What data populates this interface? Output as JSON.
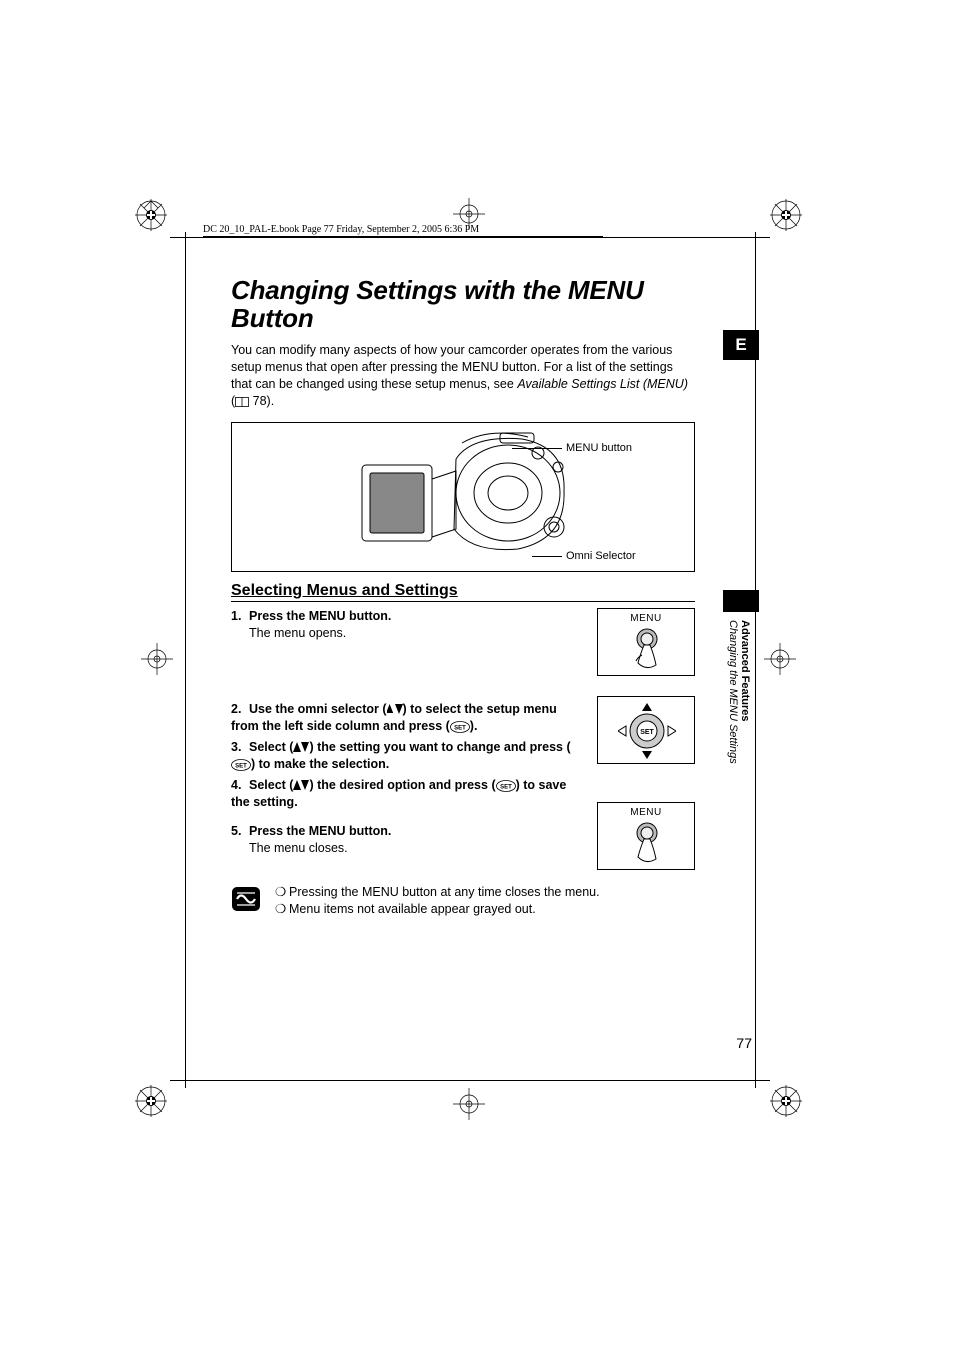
{
  "running_header": "DC 20_10_PAL-E.book  Page 77  Friday, September 2, 2005  6:36 PM",
  "title": "Changing Settings with the MENU Button",
  "intro_part1": "You can modify many aspects of how your camcorder operates from the various setup menus that open after pressing the MENU button. For a list of the settings that can be changed using these setup menus, see ",
  "intro_ital": "Available Settings List (MENU)",
  "intro_part2": " (",
  "intro_pageref": " 78).",
  "figure": {
    "callout1": "MENU button",
    "callout2": "Omni Selector"
  },
  "subhead": "Selecting Menus and Settings",
  "steps": {
    "s1_num": "1.",
    "s1_bold": "Press the MENU button.",
    "s1_body": "The menu opens.",
    "s2_num": "2.",
    "s2_bold_a": "Use the omni selector (",
    "s2_bold_b": ") to select the setup menu from the left side column and press (",
    "s2_bold_c": ").",
    "s3_num": "3.",
    "s3_bold_a": "Select (",
    "s3_bold_b": ") the setting you want to change and press (",
    "s3_bold_c": ") to make the selection.",
    "s4_num": "4.",
    "s4_bold_a": "Select (",
    "s4_bold_b": ") the desired option and press (",
    "s4_bold_c": ") to save the setting.",
    "s5_num": "5.",
    "s5_bold": "Press the MENU button.",
    "s5_body": "The menu closes."
  },
  "mini_menu_label": "MENU",
  "notes": {
    "n1": "Pressing the MENU button at any time closes the menu.",
    "n2": "Menu items not available appear grayed out."
  },
  "tab_letter": "E",
  "side_bold": "Advanced Features",
  "side_ital": "Changing the MENU Settings",
  "page_number": "77"
}
